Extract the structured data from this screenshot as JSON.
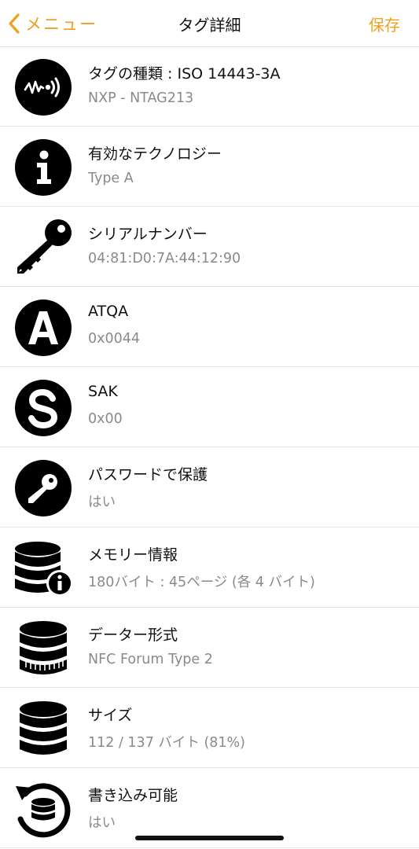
{
  "nav": {
    "back_label": "メニュー",
    "title": "タグ詳細",
    "save_label": "保存"
  },
  "rows": [
    {
      "icon": "nfc-signal-icon",
      "label": "タグの種類 : ISO 14443-3A",
      "value": "NXP - NTAG213"
    },
    {
      "icon": "info-icon",
      "label": "有効なテクノロジー",
      "value": "Type A"
    },
    {
      "icon": "key-icon",
      "label": "シリアルナンバー",
      "value": "04:81:D0:7A:44:12:90"
    },
    {
      "icon": "letter-a-icon",
      "label": "ATQA",
      "value": "0x0044"
    },
    {
      "icon": "letter-s-icon",
      "label": "SAK",
      "value": "0x00"
    },
    {
      "icon": "key-circle-icon",
      "label": "パスワードで保護",
      "value": "はい"
    },
    {
      "icon": "database-info-icon",
      "label": "メモリー情報",
      "value": "180バイト : 45ページ (各 4 バイト)"
    },
    {
      "icon": "database-format-icon",
      "label": "データー形式",
      "value": "NFC Forum Type 2"
    },
    {
      "icon": "database-icon",
      "label": "サイズ",
      "value": "112 / 137 バイト (81%)"
    },
    {
      "icon": "database-rewrite-icon",
      "label": "書き込み可能",
      "value": "はい"
    }
  ],
  "colors": {
    "accent": "#f0a020",
    "icon": "#000000",
    "secondary_text": "#8a8a8e",
    "separator": "#e4e4e6"
  }
}
